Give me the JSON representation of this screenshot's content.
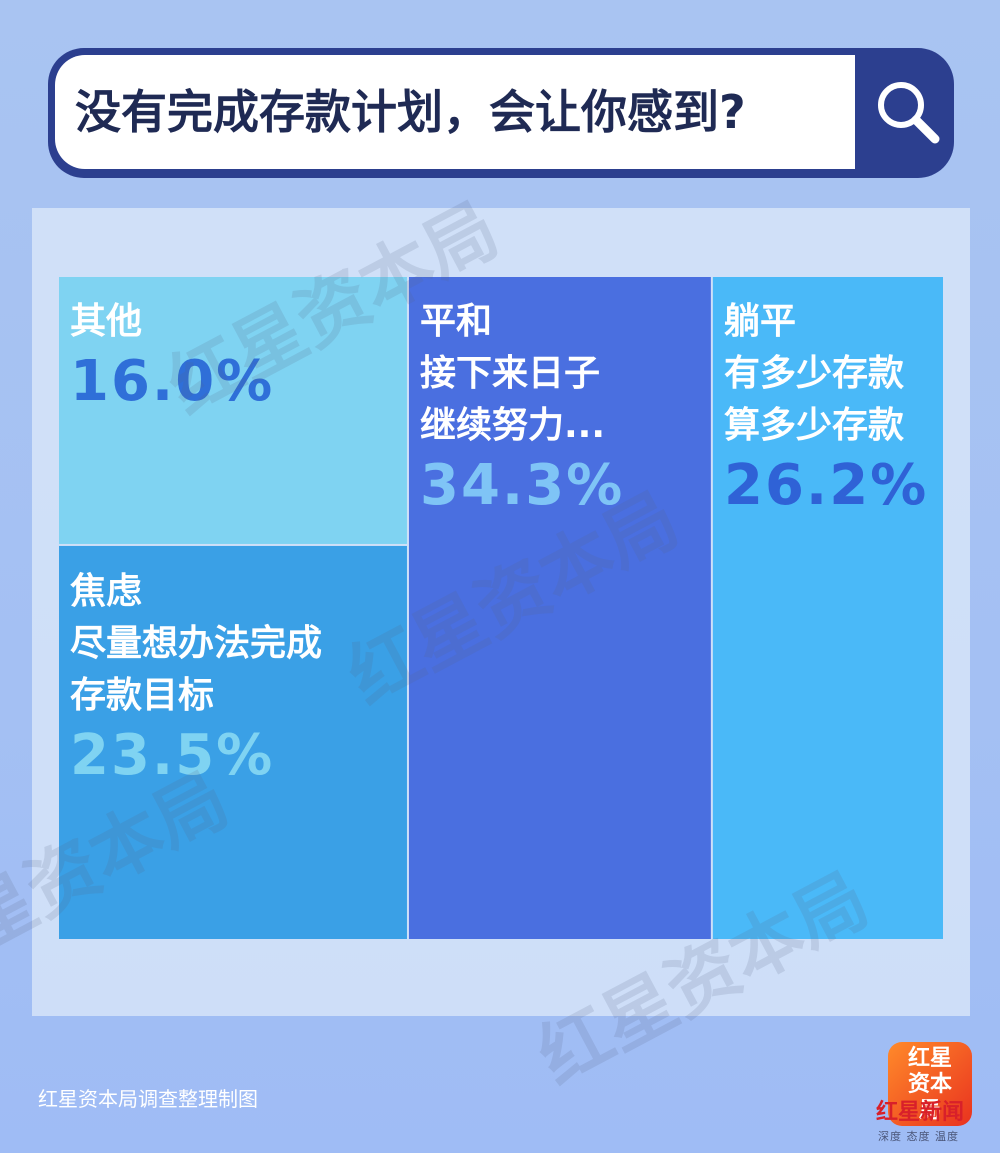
{
  "header": {
    "question": "没有完成存款计划，会让你感到?",
    "search_icon": "search-icon"
  },
  "chart_data": {
    "type": "treemap",
    "items": [
      {
        "lines": [
          "其他"
        ],
        "percent": "16.0%",
        "value": 16.0,
        "color": "#7fd3f2",
        "pct_color": "#2f6fd8"
      },
      {
        "lines": [
          "焦虑",
          "尽量想办法完成",
          "存款目标"
        ],
        "percent": "23.5%",
        "value": 23.5,
        "color": "#3aa0e6",
        "pct_color": "#7fd3f2"
      },
      {
        "lines": [
          "平和",
          "接下来日子",
          "继续努力..."
        ],
        "percent": "34.3%",
        "value": 34.3,
        "color": "#4a6fe0",
        "pct_color": "#7fc4f6"
      },
      {
        "lines": [
          "躺平",
          "有多少存款",
          "算多少存款"
        ],
        "percent": "26.2%",
        "value": 26.2,
        "color": "#4ab9f8",
        "pct_color": "#2f62d6"
      }
    ]
  },
  "footer": {
    "source": "红星资本局调查整理制图",
    "logo_text": "红星资本局",
    "brand": "红星新闻",
    "slogan": "深度 态度 温度"
  },
  "watermark": "红星资本局"
}
